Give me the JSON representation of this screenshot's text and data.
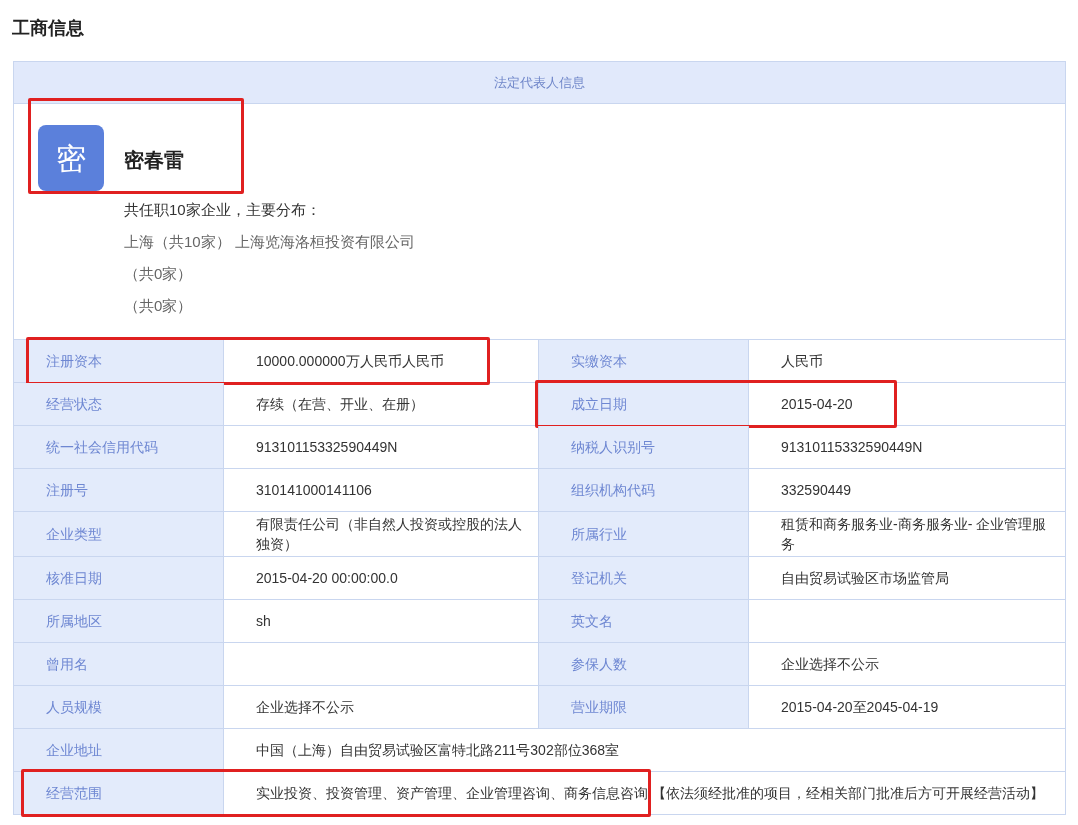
{
  "page_title": "工商信息",
  "legal_rep": {
    "section_title": "法定代表人信息",
    "avatar_char": "密",
    "name": "密春雷",
    "highlighted": true,
    "summary": "共任职10家企业，主要分布：",
    "distribution": [
      "上海（共10家） 上海览海洛桓投资有限公司",
      "（共0家）",
      "（共0家）"
    ]
  },
  "rows": [
    {
      "fields": [
        {
          "label": "注册资本",
          "value": "10000.000000万人民币人民币",
          "highlighted": true
        },
        {
          "label": "实缴资本",
          "value": "人民币",
          "highlighted": false
        }
      ]
    },
    {
      "fields": [
        {
          "label": "经营状态",
          "value": "存续（在营、开业、在册）",
          "highlighted": false
        },
        {
          "label": "成立日期",
          "value": "2015-04-20",
          "highlighted": true
        }
      ]
    },
    {
      "fields": [
        {
          "label": "统一社会信用代码",
          "value": "91310115332590449N",
          "highlighted": false
        },
        {
          "label": "纳税人识别号",
          "value": "91310115332590449N",
          "highlighted": false
        }
      ]
    },
    {
      "fields": [
        {
          "label": "注册号",
          "value": "310141000141106",
          "highlighted": false
        },
        {
          "label": "组织机构代码",
          "value": "332590449",
          "highlighted": false
        }
      ]
    },
    {
      "fields": [
        {
          "label": "企业类型",
          "value": "有限责任公司（非自然人投资或控股的法人独资）",
          "highlighted": false
        },
        {
          "label": "所属行业",
          "value": "租赁和商务服务业-商务服务业- 企业管理服务",
          "highlighted": false
        }
      ]
    },
    {
      "fields": [
        {
          "label": "核准日期",
          "value": "2015-04-20 00:00:00.0",
          "highlighted": false
        },
        {
          "label": "登记机关",
          "value": "自由贸易试验区市场监管局",
          "highlighted": false
        }
      ]
    },
    {
      "fields": [
        {
          "label": "所属地区",
          "value": "sh",
          "highlighted": false
        },
        {
          "label": "英文名",
          "highlighted": false
        }
      ]
    },
    {
      "fields": [
        {
          "label": "曾用名",
          "highlighted": false
        },
        {
          "label": "参保人数",
          "value": "企业选择不公示",
          "highlighted": false
        }
      ]
    },
    {
      "fields": [
        {
          "label": "人员规模",
          "value": "企业选择不公示",
          "highlighted": false
        },
        {
          "label": "营业期限",
          "value": "2015-04-20至2045-04-19",
          "highlighted": false
        }
      ]
    },
    {
      "fields": [
        {
          "label": "企业地址",
          "value": "中国（上海）自由贸易试验区富特北路211号302部位368室",
          "highlighted": false
        }
      ]
    },
    {
      "fields": [
        {
          "label": "经营范围",
          "value": "实业投资、投资管理、资产管理、企业管理咨询、商务信息咨询 【依法须经批准的项目，经相关部门批准后方可开展经营活动】",
          "highlighted": true
        }
      ]
    }
  ]
}
